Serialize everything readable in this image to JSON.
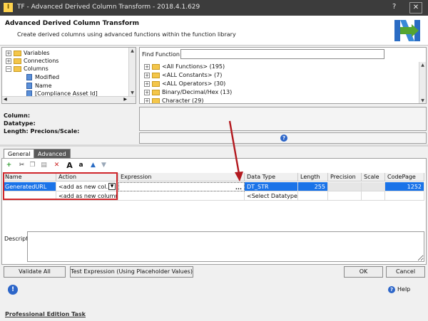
{
  "window": {
    "title": "TF - Advanced Derived Column Transform - 2018.4.1.629",
    "icon_glyph": "I",
    "help_glyph": "?",
    "close_glyph": "✕"
  },
  "header": {
    "title": "Advanced Derived Column Transform",
    "subtitle": "Create derived columns using advanced functions within the function library"
  },
  "tree": {
    "items": [
      {
        "label": "Variables",
        "expander": "+"
      },
      {
        "label": "Connections",
        "expander": "+"
      },
      {
        "label": "Columns",
        "expander": "−"
      },
      {
        "label": "Modified"
      },
      {
        "label": "Name"
      },
      {
        "label": "[Compliance Asset Id]"
      }
    ]
  },
  "functions": {
    "find_label": "Find Function:",
    "find_value": "",
    "items": [
      {
        "label": "<All Functions> (195)",
        "expander": "+"
      },
      {
        "label": "<ALL Constants> (7)",
        "expander": "+"
      },
      {
        "label": "<ALL Operators> (30)",
        "expander": "+"
      },
      {
        "label": "Binary/Decimal/Hex (13)",
        "expander": "+"
      },
      {
        "label": "Character (29)",
        "expander": "+"
      }
    ]
  },
  "info": {
    "column_label": "Column:",
    "datatype_label": "Datatype:",
    "length_label": "Length:  Precions/Scale:"
  },
  "help_icon_glyph": "?",
  "tabs": [
    {
      "label": "General",
      "active": true
    },
    {
      "label": "Advanced",
      "active": false
    }
  ],
  "toolbar": {
    "buttons": [
      {
        "name": "add-row-icon",
        "glyph": "+"
      },
      {
        "name": "cut-icon",
        "glyph": "✂"
      },
      {
        "name": "copy-icon",
        "glyph": "❐"
      },
      {
        "name": "paste-icon",
        "glyph": "▤"
      },
      {
        "name": "delete-icon",
        "glyph": "✕"
      },
      {
        "name": "uppercase-icon",
        "glyph": "A"
      },
      {
        "name": "lowercase-icon",
        "glyph": "a"
      },
      {
        "name": "move-up-icon",
        "glyph": "▲"
      },
      {
        "name": "move-down-icon",
        "glyph": "▼"
      }
    ]
  },
  "grid": {
    "columns": [
      "Name",
      "Action",
      "Expression",
      "Data Type",
      "Length",
      "Precision",
      "Scale",
      "CodePage"
    ],
    "row1": {
      "name": "GeneratedURL",
      "action": "<add as new col...",
      "expression": "",
      "data_type": "DT_STR",
      "length": "255",
      "precision": "",
      "scale": "",
      "codepage": "1252"
    },
    "row2": {
      "action": "<add as new column>",
      "data_type": "<Select Datatype>"
    },
    "ellipsis": "...",
    "dropdown_glyph": "▼"
  },
  "description": {
    "label": "Description",
    "value": ""
  },
  "buttons": {
    "validate_all": "Validate All",
    "test_expression": "Test Expression (Using Placeholder Values)",
    "ok": "OK",
    "cancel": "Cancel"
  },
  "footer": {
    "info_glyph": "!",
    "help_label": "Help",
    "edition_link": "Professional Edition Task"
  },
  "colors": {
    "selection": "#1a73e8",
    "highlight_border": "#d0262b",
    "arrow": "#b3191f",
    "folder": "#f4c64a",
    "titlebar": "#3c3c3c"
  }
}
